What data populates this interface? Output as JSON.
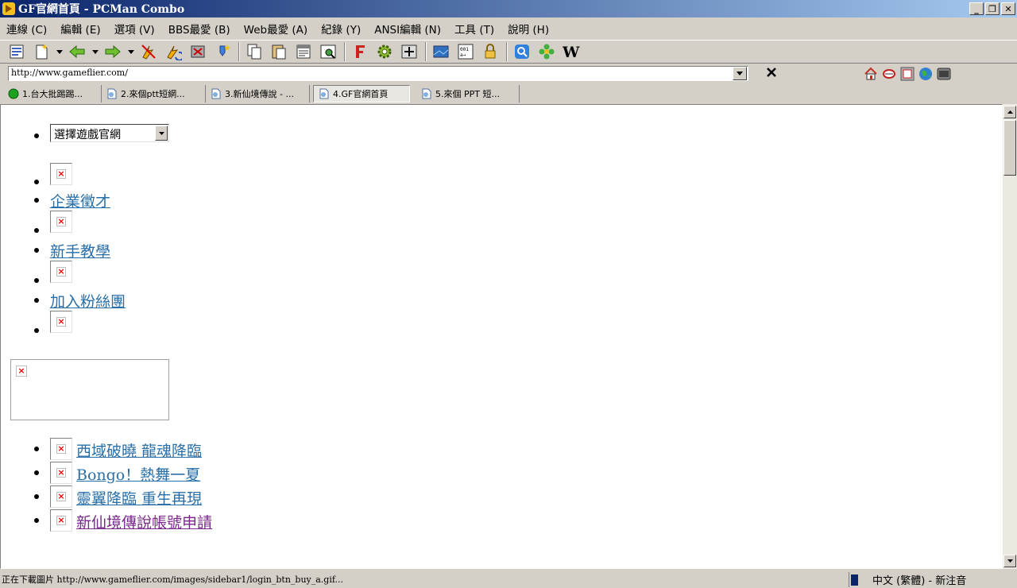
{
  "window": {
    "title": "GF官網首頁 - PCMan Combo",
    "buttons": {
      "minimize": "_",
      "restore": "❐",
      "close": "✕"
    }
  },
  "menu": [
    "連線 (C)",
    "編輯 (E)",
    "選項 (V)",
    "BBS最愛 (B)",
    "Web最愛 (A)",
    "紀錄 (Y)",
    "ANSI編輯 (N)",
    "工具 (T)",
    "說明 (H)"
  ],
  "address": {
    "url": "http://www.gameflier.com/"
  },
  "tabs": [
    {
      "label": "1.台大批踢踢...",
      "icon": "green-dot-icon",
      "active": false
    },
    {
      "label": "2.來個ptt短網...",
      "icon": "page-icon",
      "active": false
    },
    {
      "label": "3.新仙境傳說 - ...",
      "icon": "page-icon",
      "active": false
    },
    {
      "label": "4.GF官網首頁",
      "icon": "page-icon",
      "active": true
    },
    {
      "label": "5.來個 PPT 短...",
      "icon": "page-icon",
      "active": false
    }
  ],
  "content": {
    "select": {
      "value": "選擇遊戲官網"
    },
    "links_top": [
      "企業徵才",
      "新手教學",
      "加入粉絲團"
    ],
    "links_bottom": [
      "西域破曉 龍魂降臨",
      "Bongo！熱舞一夏",
      "靈翼降臨 重生再現",
      "新仙境傳說帳號申請"
    ]
  },
  "status": {
    "text": "正在下載圖片 http://www.gameflier.com/images/sidebar1/login_btn_buy_a.gif...",
    "ime": "中文 (繁體) - 新注音"
  }
}
